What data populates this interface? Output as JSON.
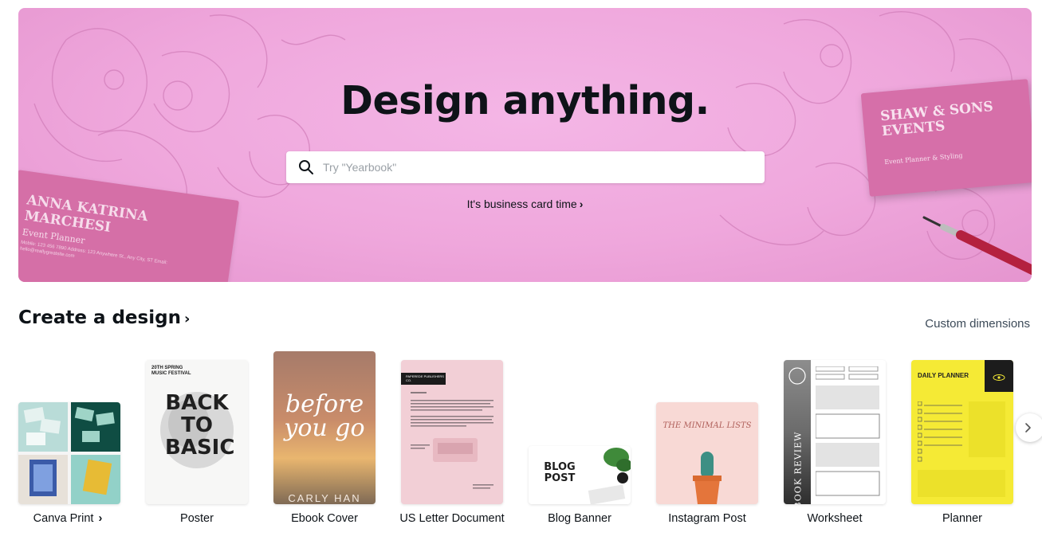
{
  "hero": {
    "title": "Design anything.",
    "search_placeholder": "Try \"Yearbook\"",
    "promo_link": "It's business card time",
    "card_left": {
      "name": "ANNA KATRINA MARCHESI",
      "role": "Event Planner",
      "info": "Mobile: 123 456 7890 Address: 123 Anywhere St., Any City, ST Email: hello@reallygreatsite.com"
    },
    "card_right": {
      "name": "SHAW & SONS EVENTS",
      "role": "Event Planner & Styling"
    }
  },
  "section": {
    "title": "Create a design",
    "custom_dimensions": "Custom dimensions"
  },
  "templates": [
    {
      "label": "Canva Print",
      "has_chevron": true
    },
    {
      "label": "Poster",
      "thumb": {
        "top": "20TH SPRING MUSIC FESTIVAL",
        "main": "BACK TO BASIC"
      }
    },
    {
      "label": "Ebook Cover",
      "thumb": {
        "main": "before you go",
        "author": "CARLY HAN"
      }
    },
    {
      "label": "US Letter Document",
      "thumb": {
        "header": "PAPEREDE PUBLISHERS CO."
      }
    },
    {
      "label": "Blog Banner",
      "thumb": {
        "main": "BLOG POST"
      }
    },
    {
      "label": "Instagram Post",
      "thumb": {
        "main": "THE MINIMAL LISTS"
      }
    },
    {
      "label": "Worksheet",
      "thumb": {
        "main": "BOOK REVIEW"
      }
    },
    {
      "label": "Planner",
      "thumb": {
        "main": "DAILY PLANNER"
      }
    }
  ],
  "colors": {
    "hero_pink": "#efa7dc",
    "card_pink": "#d56fa7",
    "planner_yellow": "#f5ea35"
  }
}
